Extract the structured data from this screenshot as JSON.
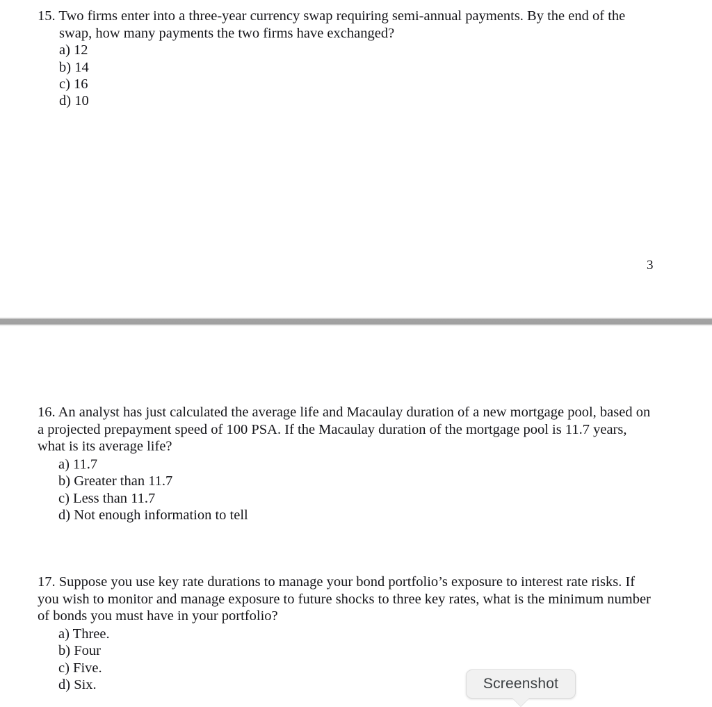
{
  "document": {
    "top_page": {
      "page_number": "3",
      "questions": [
        {
          "id": "q15",
          "text": "15. Two firms enter into a three-year currency swap requiring semi-annual payments. By the end of the swap, how many payments the two firms have exchanged?",
          "options": [
            "a) 12",
            "b) 14",
            "c) 16",
            "d) 10"
          ]
        }
      ]
    },
    "bottom_page": {
      "questions": [
        {
          "id": "q16",
          "text": "16. An analyst has just calculated the average life and Macaulay duration of a new mortgage pool, based on a projected prepayment speed of 100 PSA. If the Macaulay duration of the mortgage pool is 11.7 years, what is its average life?",
          "options": [
            "a) 11.7",
            "b) Greater than 11.7",
            "c) Less than 11.7",
            "d) Not enough information to tell"
          ]
        },
        {
          "id": "q17",
          "text": "17. Suppose you use key rate durations to manage your bond portfolio’s exposure to interest rate risks. If you wish to monitor and manage exposure to future shocks to three key rates, what is the minimum number of bonds you must have in your portfolio?",
          "options": [
            "a) Three.",
            "b) Four",
            "c) Five.",
            "d) Six."
          ]
        }
      ]
    }
  },
  "overlay": {
    "tooltip": {
      "label": "Screenshot",
      "background_color": "#f1f1f1",
      "text_color": "#3c4043",
      "border_color": "#dcdcdc"
    }
  },
  "separator": {
    "color": "#a0a0a0"
  }
}
